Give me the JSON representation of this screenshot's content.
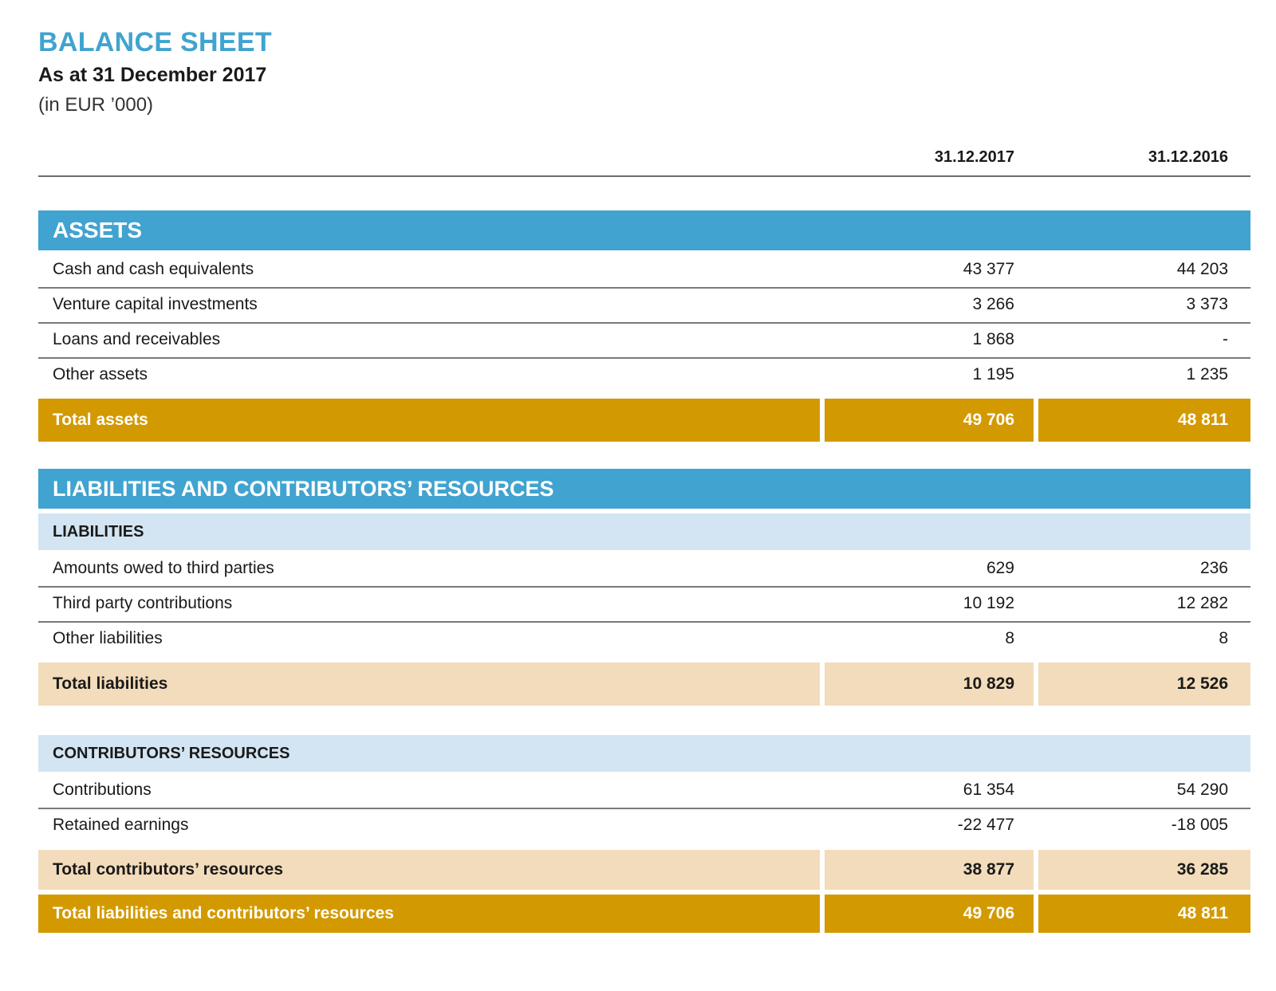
{
  "header": {
    "title": "BALANCE SHEET",
    "subtitle": "As at 31 December 2017",
    "unit": "(in EUR ’000)"
  },
  "columns": [
    "31.12.2017",
    "31.12.2016"
  ],
  "assets": {
    "heading": "ASSETS",
    "rows": [
      {
        "label": "Cash and cash equivalents",
        "v2017": "43 377",
        "v2016": "44 203"
      },
      {
        "label": "Venture capital investments",
        "v2017": "3 266",
        "v2016": "3 373"
      },
      {
        "label": "Loans and receivables",
        "v2017": "1 868",
        "v2016": "-"
      },
      {
        "label": "Other assets",
        "v2017": "1 195",
        "v2016": "1 235"
      }
    ],
    "total": {
      "label": "Total assets",
      "v2017": "49 706",
      "v2016": "48 811"
    }
  },
  "liab_and_resources": {
    "heading": "LIABILITIES AND CONTRIBUTORS’ RESOURCES",
    "liabilities": {
      "heading": "LIABILITIES",
      "rows": [
        {
          "label": "Amounts owed to third parties",
          "v2017": "629",
          "v2016": "236"
        },
        {
          "label": "Third party contributions",
          "v2017": "10 192",
          "v2016": "12 282"
        },
        {
          "label": "Other liabilities",
          "v2017": "8",
          "v2016": "8"
        }
      ],
      "total": {
        "label": "Total liabilities",
        "v2017": "10 829",
        "v2016": "12 526"
      }
    },
    "resources": {
      "heading": "CONTRIBUTORS’ RESOURCES",
      "rows": [
        {
          "label": "Contributions",
          "v2017": "61 354",
          "v2016": "54 290"
        },
        {
          "label": "Retained earnings",
          "v2017": "-22 477",
          "v2016": "-18 005"
        }
      ],
      "total": {
        "label": "Total contributors’ resources",
        "v2017": "38 877",
        "v2016": "36 285"
      }
    },
    "grand_total": {
      "label": "Total liabilities and contributors’ resources",
      "v2017": "49 706",
      "v2016": "48 811"
    }
  },
  "colors": {
    "band_blue": "#41a3cf",
    "sub_blue": "#d3e5f2",
    "gold": "#d39a00",
    "light_gold": "#f3dcbb"
  }
}
